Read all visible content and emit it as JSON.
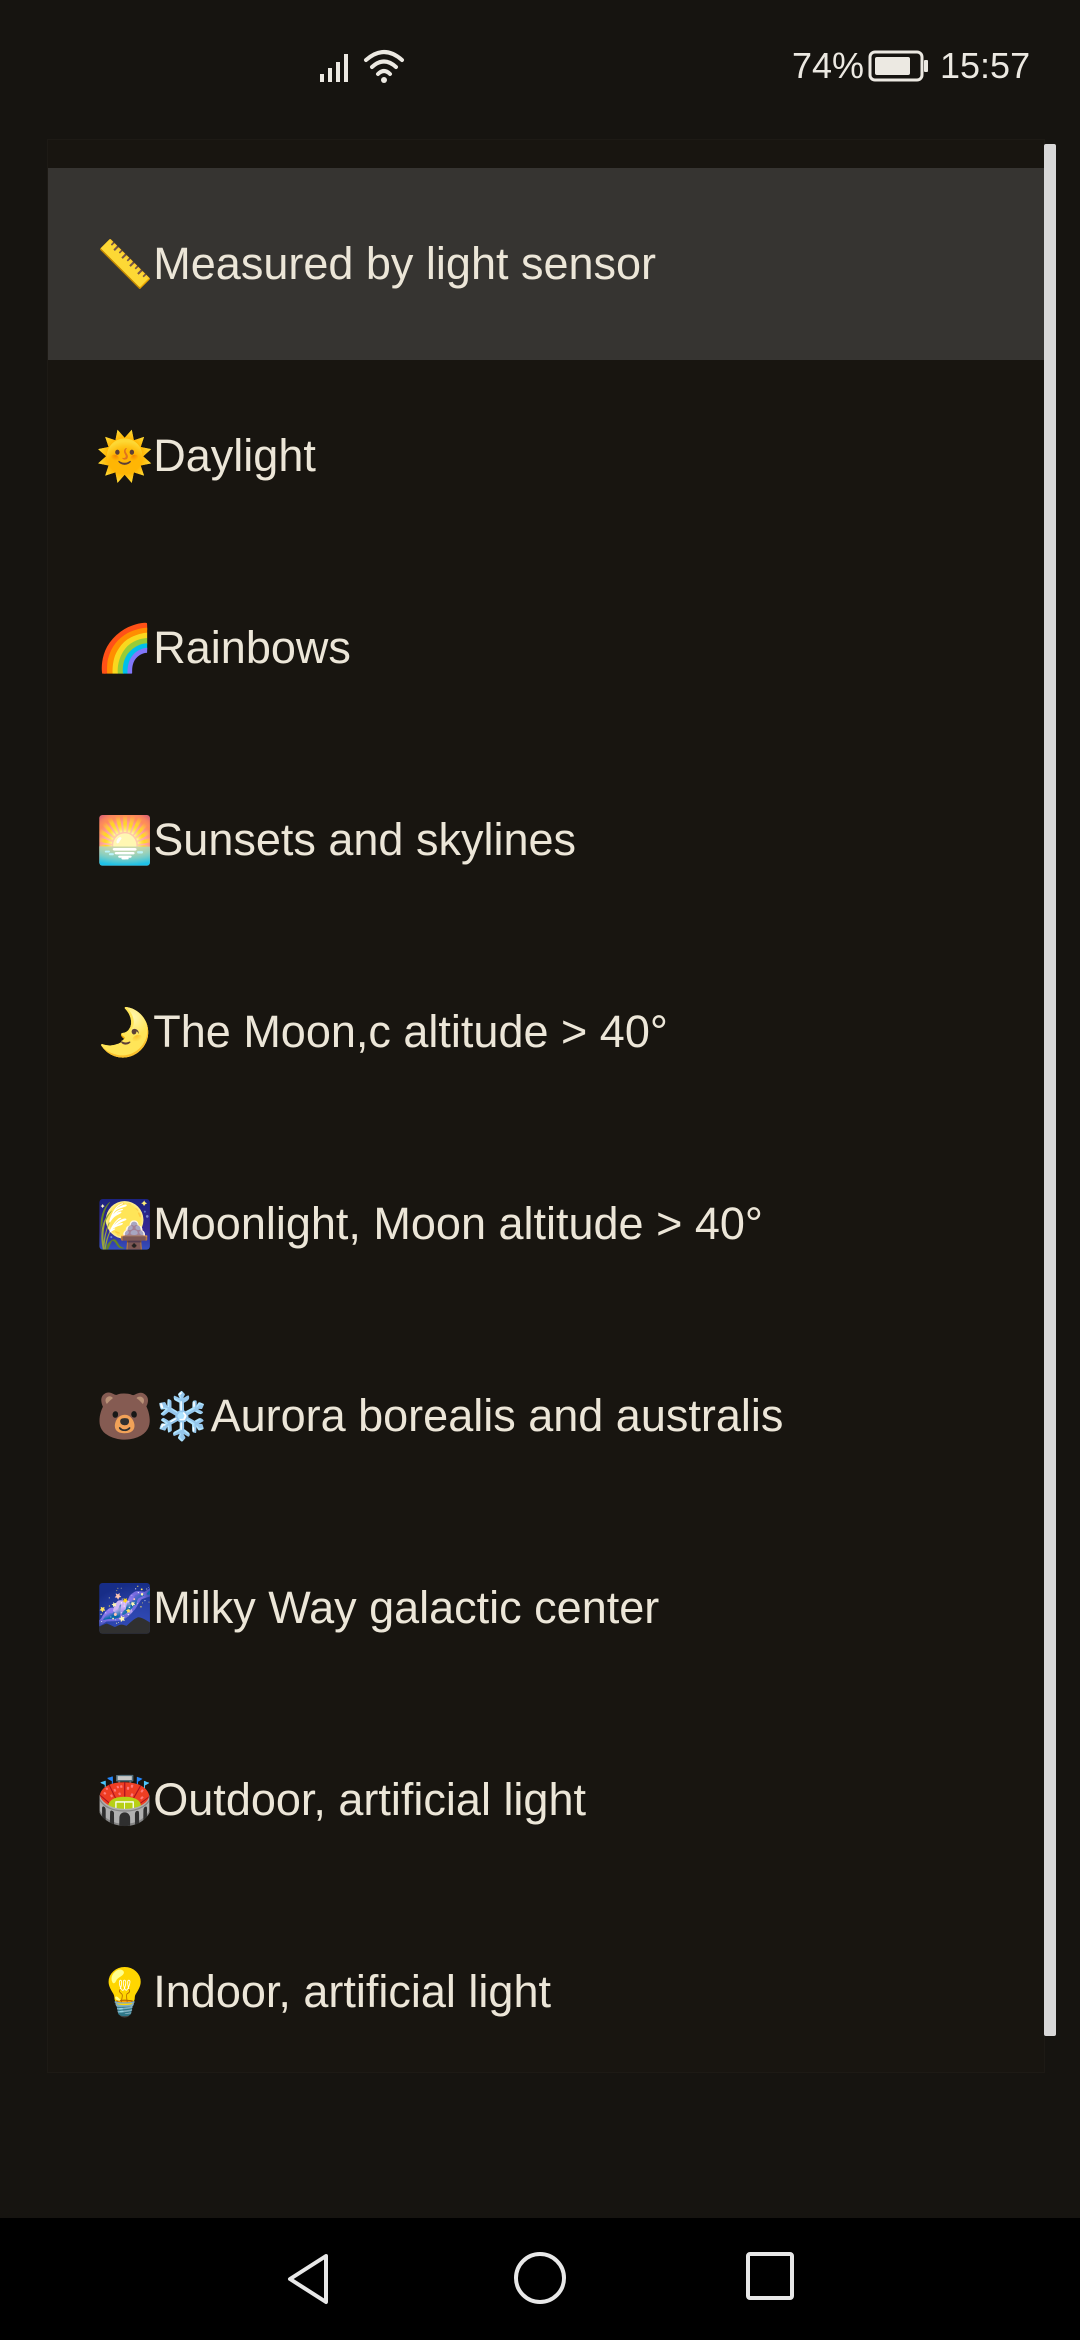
{
  "status_bar": {
    "battery_percent": "74%",
    "time": "15:57",
    "icons": [
      "signal-icon",
      "wifi-icon",
      "battery-icon"
    ]
  },
  "list": {
    "selected_index": 0,
    "items": [
      {
        "emoji": "📏",
        "label": "Measured by light sensor"
      },
      {
        "emoji": "🌞",
        "label": "Daylight"
      },
      {
        "emoji": "🌈",
        "label": "Rainbows"
      },
      {
        "emoji": "🌅",
        "label": "Sunsets and skylines"
      },
      {
        "emoji": "🌛",
        "label": "The Moon,c altitude > 40°"
      },
      {
        "emoji": "🎑",
        "label": "Moonlight, Moon altitude > 40°"
      },
      {
        "emoji": "🐻❄️",
        "label": "Aurora borealis and australis"
      },
      {
        "emoji": "🌌",
        "label": "Milky Way galactic center"
      },
      {
        "emoji": "🏟️",
        "label": "Outdoor, artificial light"
      },
      {
        "emoji": "💡",
        "label": "Indoor, artificial light"
      }
    ]
  },
  "nav_bar": {
    "icons": [
      "back-icon",
      "home-icon",
      "recents-icon"
    ]
  },
  "colors": {
    "background": "#161410",
    "dialog_background": "#181510",
    "selected_row": "#363431",
    "text": "#ece6d8",
    "nav_background": "#000000"
  }
}
